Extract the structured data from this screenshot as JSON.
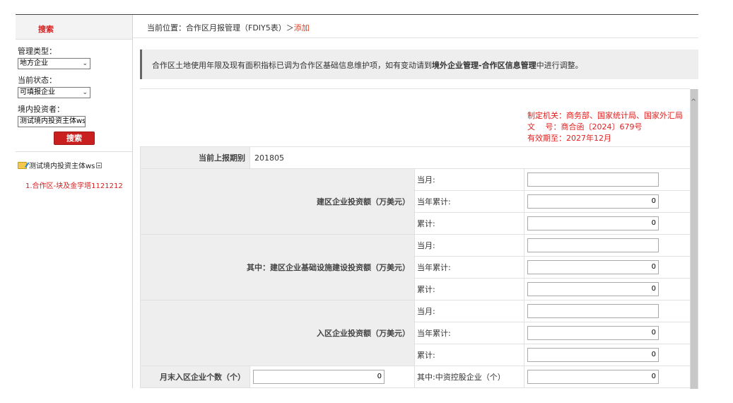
{
  "sidebar": {
    "search_title": "搜索",
    "mgmt_type_label": "管理类型：",
    "mgmt_type_value": "地方企业",
    "status_label": "当前状态：",
    "status_value": "可填报企业",
    "investor_label": "境内投资者：",
    "investor_value": "测试境内投资主体ws",
    "search_button": "搜索",
    "tree_root": "测试境内投资主体ws",
    "tree_child": "1.合作区-块及金字塔1121212"
  },
  "breadcrumb": {
    "prefix": "当前位置：合作区月报管理（FDIY5表）＞",
    "current": "添加"
  },
  "notice": {
    "text_before": "合作区土地使用年限及现有面积指标已调为合作区基础信息维护项，如有变动请到",
    "bold": "境外企业管理-合作区信息管理",
    "text_after": "中进行调整。"
  },
  "regulator": {
    "line1": "制定机关：商务部、国家统计局、国家外汇局",
    "line2": "文　 号：商合函〔2024〕679号",
    "line3": "有效期至：2027年12月"
  },
  "form": {
    "period_label": "当前上报期别",
    "period_value": "201805",
    "groups": [
      {
        "label": "建区企业投资额（万美元）",
        "rows": [
          {
            "sub": "当月:",
            "value": ""
          },
          {
            "sub": "当年累计:",
            "value": "0"
          },
          {
            "sub": "累计:",
            "value": "0"
          }
        ]
      },
      {
        "label": "其中：建区企业基础设施建设投资额（万美元）",
        "rows": [
          {
            "sub": "当月:",
            "value": ""
          },
          {
            "sub": "当年累计:",
            "value": "0"
          },
          {
            "sub": "累计:",
            "value": "0"
          }
        ]
      },
      {
        "label": "入区企业投资额（万美元）",
        "rows": [
          {
            "sub": "当月:",
            "value": ""
          },
          {
            "sub": "当年累计:",
            "value": "0"
          },
          {
            "sub": "累计:",
            "value": "0"
          }
        ]
      }
    ],
    "last_row": {
      "label": "月末入区企业个数（个）",
      "value": "0",
      "sub": "其中:中资控股企业（个）",
      "sub_value": "0"
    }
  }
}
